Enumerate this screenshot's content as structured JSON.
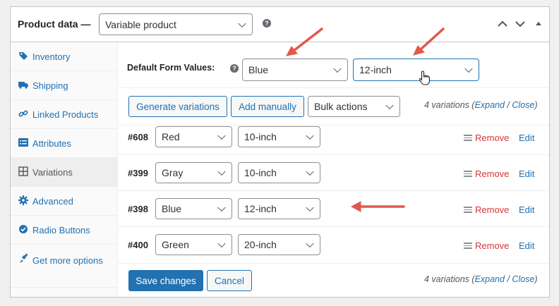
{
  "header": {
    "title": "Product data —",
    "product_type": "Variable product",
    "help_symbol": "?"
  },
  "sidebar": {
    "items": [
      {
        "label": "Inventory",
        "icon": "tag-icon"
      },
      {
        "label": "Shipping",
        "icon": "truck-icon"
      },
      {
        "label": "Linked Products",
        "icon": "link-icon"
      },
      {
        "label": "Attributes",
        "icon": "list-icon"
      },
      {
        "label": "Variations",
        "icon": "grid-icon",
        "active": true
      },
      {
        "label": "Advanced",
        "icon": "gear-icon"
      },
      {
        "label": "Radio Buttons",
        "icon": "check-circle-icon"
      },
      {
        "label": "Get more options",
        "icon": "plug-icon"
      }
    ]
  },
  "defaults": {
    "label": "Default Form Values:",
    "help_symbol": "?",
    "color": "Blue",
    "size": "12-inch"
  },
  "toolbar": {
    "generate": "Generate variations",
    "add_manually": "Add manually",
    "bulk": "Bulk actions"
  },
  "count": {
    "prefix": "4 variations (",
    "expand": "Expand",
    "sep": " / ",
    "close": "Close",
    "suffix": ")"
  },
  "variations": [
    {
      "id": "#608",
      "color": "Red",
      "size": "10-inch"
    },
    {
      "id": "#399",
      "color": "Gray",
      "size": "10-inch"
    },
    {
      "id": "#398",
      "color": "Blue",
      "size": "12-inch"
    },
    {
      "id": "#400",
      "color": "Green",
      "size": "20-inch"
    }
  ],
  "row_actions": {
    "remove": "Remove",
    "edit": "Edit"
  },
  "footer": {
    "save": "Save changes",
    "cancel": "Cancel"
  },
  "colors": {
    "accent": "#2271b1",
    "danger": "#d63638",
    "annotation_arrow": "#e2574c"
  }
}
